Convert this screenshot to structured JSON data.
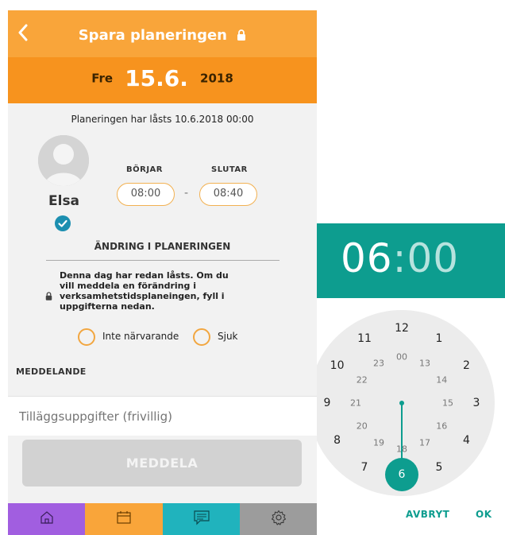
{
  "header": {
    "title": "Spara planeringen"
  },
  "date": {
    "weekday": "Fre",
    "day_month": "15.6.",
    "year": "2018"
  },
  "locked_info": "Planeringen har låsts 10.6.2018 00:00",
  "person": {
    "name": "Elsa"
  },
  "times": {
    "start_label": "BÖRJAR",
    "end_label": "SLUTAR",
    "start": "08:00",
    "separator": "-",
    "end": "08:40"
  },
  "change": {
    "title": "ÄNDRING I PLANERINGEN",
    "notice": "Denna dag har redan låsts. Om du vill meddela en förändring i verksamhetstidsplaneingen, fyll i uppgifterna nedan."
  },
  "options": [
    {
      "label": "Inte närvarande"
    },
    {
      "label": "Sjuk"
    }
  ],
  "message": {
    "label": "MEDDELANDE",
    "placeholder": "Tilläggsuppgifter (frivillig)"
  },
  "send_button": "MEDDELA",
  "nav": [
    {
      "icon": "home-icon",
      "color": "#a15ee0"
    },
    {
      "icon": "calendar-icon",
      "color": "#f9a53a"
    },
    {
      "icon": "message-icon",
      "color": "#20b3bd"
    },
    {
      "icon": "gear-icon",
      "color": "#9c9c9c"
    }
  ],
  "time_picker": {
    "hours": "06",
    "separator": ":",
    "minutes": "00",
    "outer_numbers": [
      "12",
      "1",
      "2",
      "3",
      "4",
      "5",
      "6",
      "7",
      "8",
      "9",
      "10",
      "11"
    ],
    "inner_numbers": [
      "00",
      "13",
      "14",
      "15",
      "16",
      "17",
      "18",
      "19",
      "20",
      "21",
      "22",
      "23"
    ],
    "selected": "6",
    "cancel": "AVBRYT",
    "ok": "OK"
  },
  "colors": {
    "orange": "#f9a53a",
    "orange_dark": "#f7931e",
    "teal": "#0d9d8f",
    "check_blue": "#1c8fb0"
  }
}
